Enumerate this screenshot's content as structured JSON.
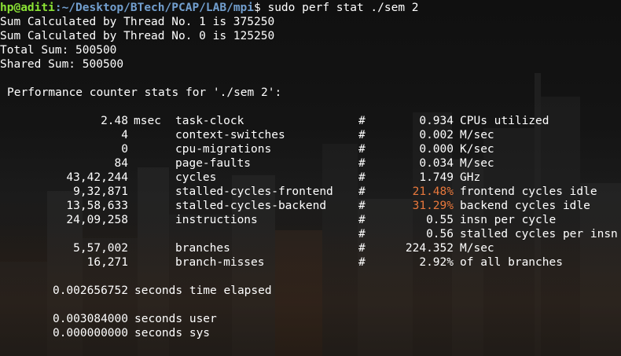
{
  "prompt": {
    "user_host": "hp@aditi",
    "path": ":~/Desktop/BTech/PCAP/LAB/mpi",
    "command": "$ sudo perf stat ./sem 2"
  },
  "program_output": [
    "Sum Calculated by Thread No. 1 is 375250",
    "Sum Calculated by Thread No. 0 is 125250",
    "Total Sum: 500500",
    "Shared Sum: 500500"
  ],
  "stats_header": "Performance counter stats for './sem 2':",
  "stats": [
    {
      "count": "2.48",
      "unit": "msec",
      "event": "task-clock",
      "hash": "#",
      "ratio": "0.934",
      "desc": "CPUs utilized",
      "highlight": false
    },
    {
      "count": "4",
      "unit": "",
      "event": "context-switches",
      "hash": "#",
      "ratio": "0.002",
      "desc": "M/sec",
      "highlight": false
    },
    {
      "count": "0",
      "unit": "",
      "event": "cpu-migrations",
      "hash": "#",
      "ratio": "0.000",
      "desc": "K/sec",
      "highlight": false
    },
    {
      "count": "84",
      "unit": "",
      "event": "page-faults",
      "hash": "#",
      "ratio": "0.034",
      "desc": "M/sec",
      "highlight": false
    },
    {
      "count": "43,42,244",
      "unit": "",
      "event": "cycles",
      "hash": "#",
      "ratio": "1.749",
      "desc": "GHz",
      "highlight": false
    },
    {
      "count": "9,32,871",
      "unit": "",
      "event": "stalled-cycles-frontend",
      "hash": "#",
      "ratio": "21.48%",
      "desc": "frontend cycles idle",
      "highlight": true
    },
    {
      "count": "13,58,633",
      "unit": "",
      "event": "stalled-cycles-backend",
      "hash": "#",
      "ratio": "31.29%",
      "desc": "backend cycles idle",
      "highlight": true
    },
    {
      "count": "24,09,258",
      "unit": "",
      "event": "instructions",
      "hash": "#",
      "ratio": "0.55",
      "desc": "insn per cycle",
      "highlight": false
    },
    {
      "count": "",
      "unit": "",
      "event": "",
      "hash": "#",
      "ratio": "0.56",
      "desc": "stalled cycles per insn",
      "highlight": false
    },
    {
      "count": "5,57,002",
      "unit": "",
      "event": "branches",
      "hash": "#",
      "ratio": "224.352",
      "desc": "M/sec",
      "highlight": false
    },
    {
      "count": "16,271",
      "unit": "",
      "event": "branch-misses",
      "hash": "#",
      "ratio": "2.92%",
      "desc": "of all branches",
      "highlight": false
    }
  ],
  "elapsed": {
    "value": "0.002656752",
    "label": "seconds time elapsed"
  },
  "times": [
    {
      "value": "0.003084000",
      "label": "seconds user"
    },
    {
      "value": "0.000000000",
      "label": "seconds sys"
    }
  ],
  "colors": {
    "prompt_user": "#8ae234",
    "prompt_path": "#729fcf",
    "highlight": "#e8783c",
    "text": "#ffffff"
  }
}
